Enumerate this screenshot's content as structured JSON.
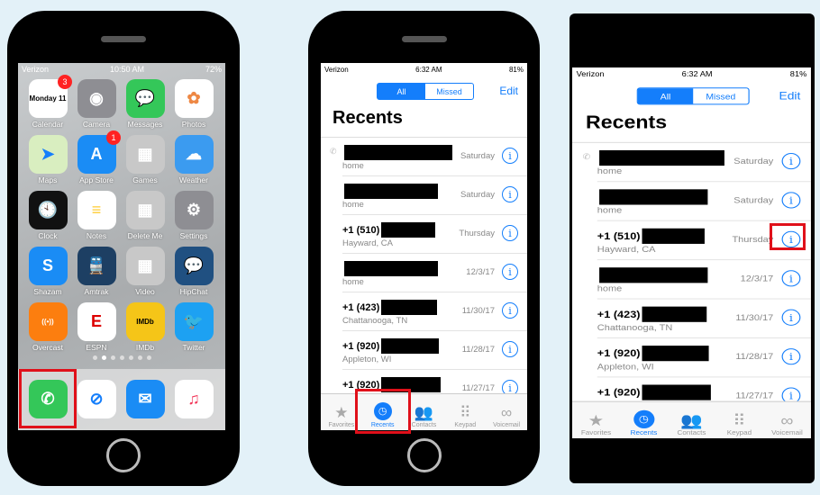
{
  "home": {
    "status": {
      "carrier": "Verizon",
      "time": "10:50 AM",
      "battery": "72%"
    },
    "apps": [
      {
        "label": "Calendar",
        "glyph": "Monday 11",
        "color": "#ffffff",
        "fg": "#000",
        "badge": "3"
      },
      {
        "label": "Camera",
        "glyph": "◉",
        "color": "#8e8e93"
      },
      {
        "label": "Messages",
        "glyph": "💬",
        "color": "#34c759"
      },
      {
        "label": "Photos",
        "glyph": "✿",
        "color": "#ffffff",
        "fg": "#e84"
      },
      {
        "label": "Maps",
        "glyph": "➤",
        "color": "#d9eec0",
        "fg": "#147efb"
      },
      {
        "label": "App Store",
        "glyph": "A",
        "color": "#1a8cf5",
        "badge": "1"
      },
      {
        "label": "Games",
        "glyph": "▦",
        "color": "#c8c8c8"
      },
      {
        "label": "Weather",
        "glyph": "☁",
        "color": "#3b9bf0"
      },
      {
        "label": "Clock",
        "glyph": "🕙",
        "color": "#111"
      },
      {
        "label": "Notes",
        "glyph": "≡",
        "color": "#fff",
        "fg": "#fc3"
      },
      {
        "label": "Delete Me",
        "glyph": "▦",
        "color": "#c8c8c8"
      },
      {
        "label": "Settings",
        "glyph": "⚙",
        "color": "#8e8e93"
      },
      {
        "label": "Shazam",
        "glyph": "S",
        "color": "#1a8cf5"
      },
      {
        "label": "Amtrak",
        "glyph": "🚆",
        "color": "#1d3f63"
      },
      {
        "label": "Video",
        "glyph": "▦",
        "color": "#c8c8c8"
      },
      {
        "label": "HipChat",
        "glyph": "💬",
        "color": "#205081"
      },
      {
        "label": "Overcast",
        "glyph": "((•))",
        "color": "#fc7e0f"
      },
      {
        "label": "ESPN",
        "glyph": "E",
        "color": "#fff",
        "fg": "#d00"
      },
      {
        "label": "IMDb",
        "glyph": "IMDb",
        "color": "#f5c518",
        "fg": "#000"
      },
      {
        "label": "Twitter",
        "glyph": "🐦",
        "color": "#1da1f2"
      }
    ],
    "dock": [
      {
        "name": "phone",
        "glyph": "✆",
        "color": "#34c759"
      },
      {
        "name": "safari",
        "glyph": "⊘",
        "color": "#fff",
        "fg": "#147efb"
      },
      {
        "name": "mail",
        "glyph": "✉",
        "color": "#1a8cf5"
      },
      {
        "name": "music",
        "glyph": "♫",
        "color": "#fff",
        "fg": "#f2385a"
      }
    ]
  },
  "recents": {
    "status": {
      "carrier": "Verizon",
      "time": "6:32 AM",
      "battery": "81%"
    },
    "segments": {
      "all": "All",
      "missed": "Missed"
    },
    "edit": "Edit",
    "title": "Recents",
    "rows": [
      {
        "name": "",
        "redact": 120,
        "sub": "home",
        "date": "Saturday",
        "outgoing": true
      },
      {
        "name": "",
        "redact": 104,
        "sub": "home",
        "date": "Saturday"
      },
      {
        "name": "+1 (510)",
        "redact": 60,
        "sub": "Hayward, CA",
        "date": "Thursday"
      },
      {
        "name": "",
        "redact": 104,
        "sub": "home",
        "date": "12/3/17"
      },
      {
        "name": "+1 (423)",
        "redact": 62,
        "sub": "Chattanooga, TN",
        "date": "11/30/17"
      },
      {
        "name": "+1 (920)",
        "redact": 64,
        "sub": "Appleton, WI",
        "date": "11/28/17"
      },
      {
        "name": "+1 (920)",
        "redact": 66,
        "sub": "Appleton, WI",
        "date": "11/27/17"
      }
    ],
    "tabs": [
      {
        "label": "Favorites",
        "glyph": "★"
      },
      {
        "label": "Recents",
        "glyph": "◷",
        "active": true
      },
      {
        "label": "Contacts",
        "glyph": "👥"
      },
      {
        "label": "Keypad",
        "glyph": "⠿"
      },
      {
        "label": "Voicemail",
        "glyph": "∞"
      }
    ]
  },
  "highlight_color": "#e0101a"
}
